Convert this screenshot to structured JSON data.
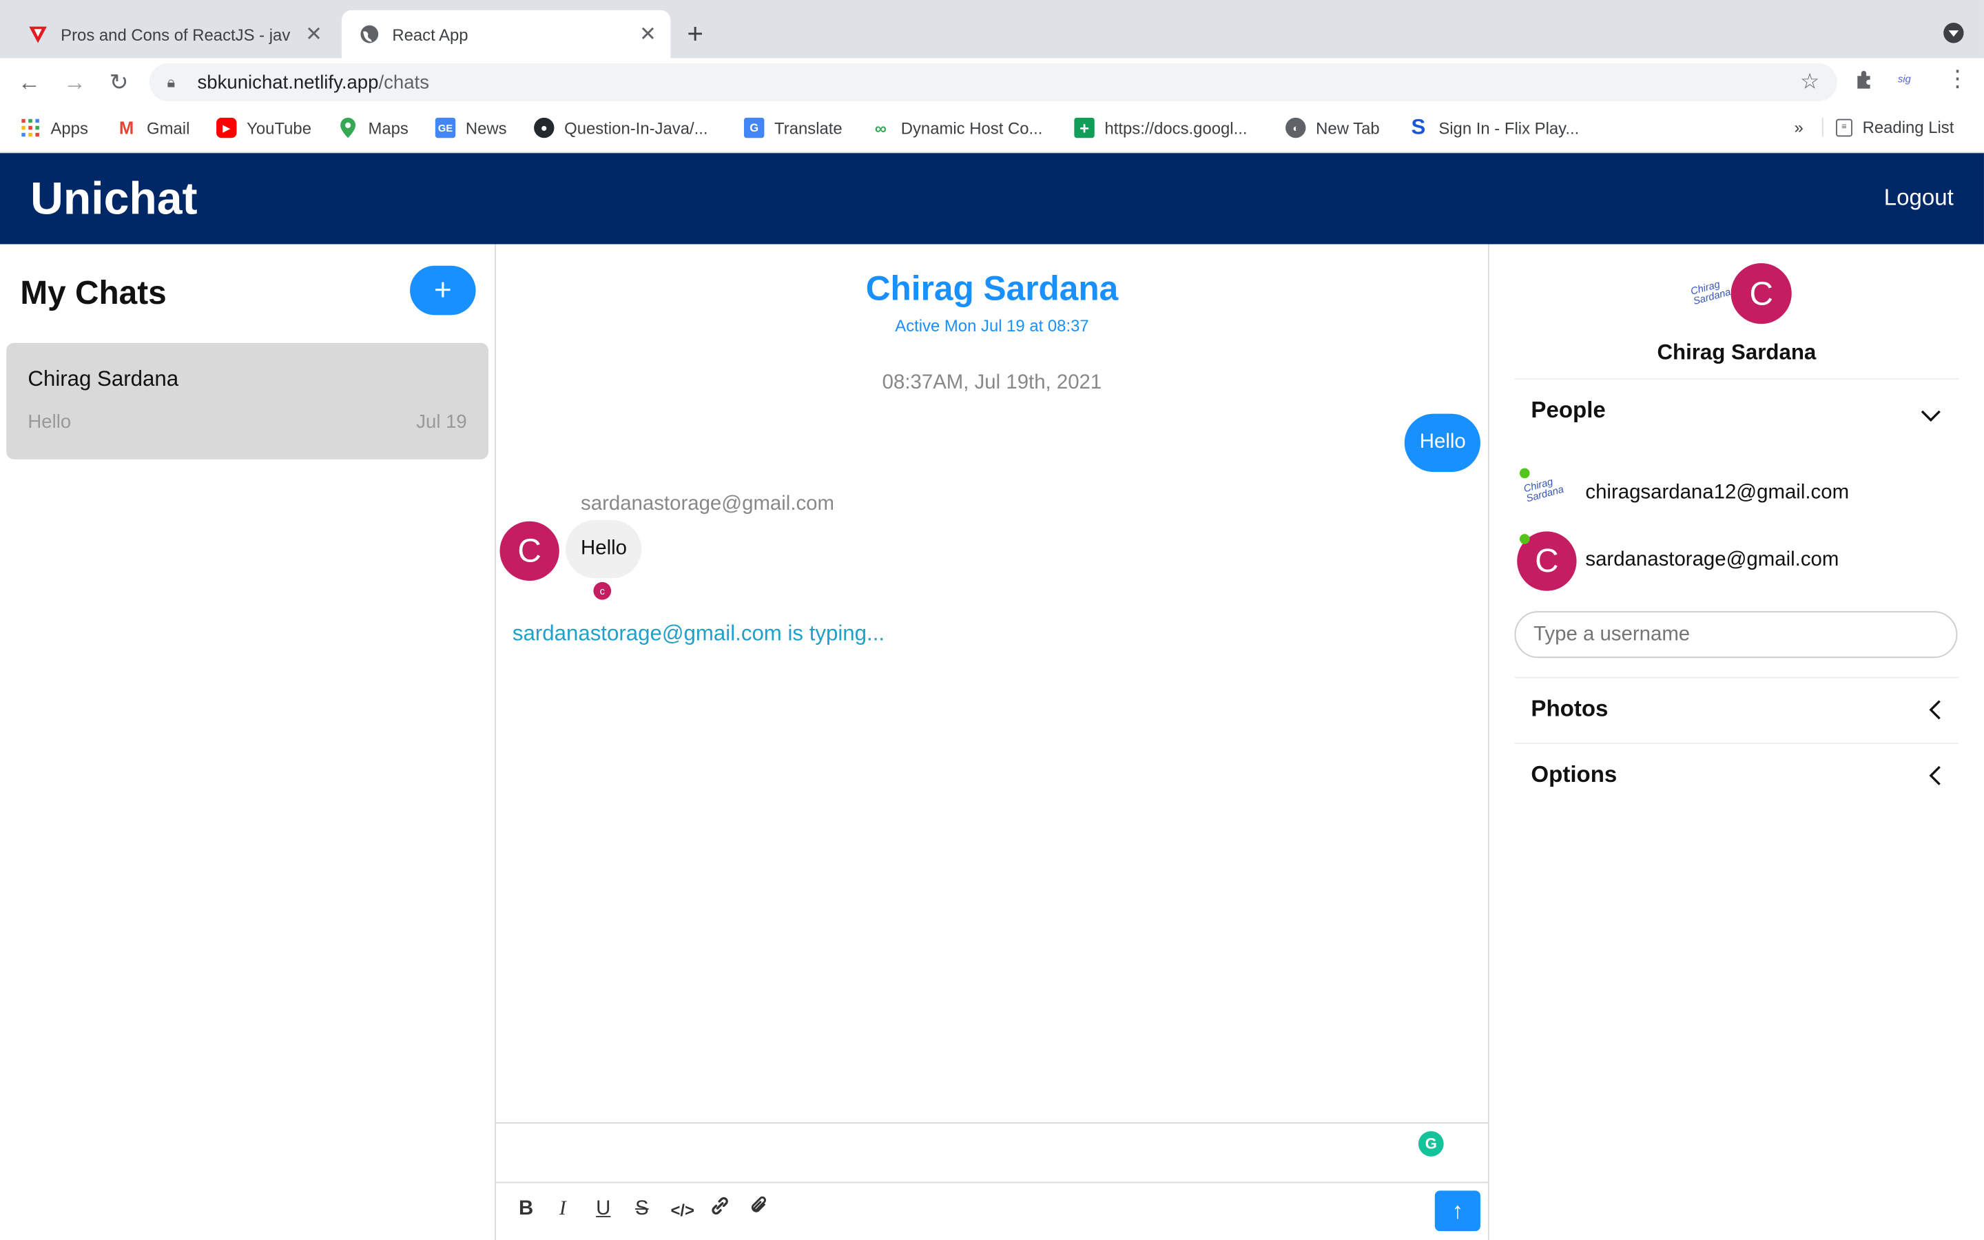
{
  "browser": {
    "tabs": [
      {
        "title": "Pros and Cons of ReactJS - jav",
        "active": false
      },
      {
        "title": "React App",
        "active": true
      }
    ],
    "url_host": "sbkunichat.netlify.app",
    "url_path": "/chats",
    "bookmarks": [
      {
        "label": "Apps"
      },
      {
        "label": "Gmail"
      },
      {
        "label": "YouTube"
      },
      {
        "label": "Maps"
      },
      {
        "label": "News"
      },
      {
        "label": "Question-In-Java/..."
      },
      {
        "label": "Translate"
      },
      {
        "label": "Dynamic Host Co..."
      },
      {
        "label": "https://docs.googl..."
      },
      {
        "label": "New Tab"
      },
      {
        "label": "Sign In - Flix Play..."
      }
    ],
    "more_bookmarks": "»",
    "reading_list": "Reading List"
  },
  "app": {
    "brand": "Unichat",
    "logout": "Logout"
  },
  "sidebar": {
    "title": "My Chats",
    "new_chat_label": "+",
    "chats": [
      {
        "name": "Chirag Sardana",
        "last_message": "Hello",
        "date": "Jul 19"
      }
    ]
  },
  "chat": {
    "title": "Chirag Sardana",
    "subtitle": "Active Mon Jul 19 at 08:37",
    "timestamp": "08:37AM, Jul 19th, 2021",
    "my_message": "Hello",
    "other_sender": "sardanastorage@gmail.com",
    "other_message": "Hello",
    "other_avatar_letter": "C",
    "read_receipt_letter": "c",
    "typing": "sardanastorage@gmail.com is typing...",
    "grammarly": "G"
  },
  "details": {
    "avatar_letter": "C",
    "name": "Chirag Sardana",
    "people_title": "People",
    "people": [
      {
        "email": "chiragsardana12@gmail.com",
        "online": true
      },
      {
        "email": "sardanastorage@gmail.com",
        "online": true,
        "avatar_letter": "C"
      }
    ],
    "username_placeholder": "Type a username",
    "photos_title": "Photos",
    "options_title": "Options"
  },
  "colors": {
    "appbar": "#002766",
    "accent": "#1890ff",
    "avatar": "#c41d62",
    "online": "#52c41a"
  }
}
